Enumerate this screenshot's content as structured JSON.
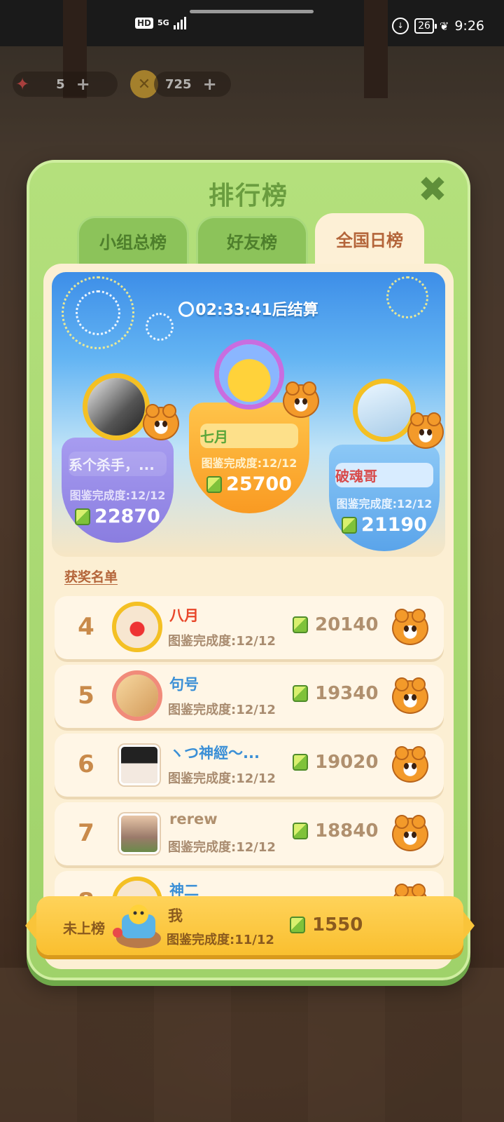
{
  "status_bar": {
    "hd": "HD",
    "network": "5G",
    "battery": "26",
    "time": "9:26"
  },
  "resources": {
    "stamina": "5",
    "coins": "725"
  },
  "panel": {
    "title": "排行榜",
    "tabs": [
      {
        "label": "小组总榜",
        "active": false
      },
      {
        "label": "好友榜",
        "active": false
      },
      {
        "label": "全国日榜",
        "active": true
      }
    ],
    "timer": {
      "time": "02:33:41",
      "suffix": "后结算"
    },
    "podium": {
      "first": {
        "name": "七月",
        "progress": "图鉴完成度:12/12",
        "score": "25700"
      },
      "second": {
        "name": "系个杀手，...",
        "progress": "图鉴完成度:12/12",
        "score": "22870"
      },
      "third": {
        "name": "破魂哥",
        "progress": "图鉴完成度:12/12",
        "score": "21190"
      }
    },
    "award_title": "获奖名单",
    "list": [
      {
        "rank": "4",
        "name": "八月",
        "progress": "图鉴完成度:12/12",
        "score": "20140",
        "name_color": "#e8472a"
      },
      {
        "rank": "5",
        "name": "句号",
        "progress": "图鉴完成度:12/12",
        "score": "19340",
        "name_color": "#3a8fd6"
      },
      {
        "rank": "6",
        "name": "ヽつ神經～...",
        "progress": "图鉴完成度:12/12",
        "score": "19020",
        "name_color": "#3a8fd6"
      },
      {
        "rank": "7",
        "name": "rerew",
        "progress": "图鉴完成度:12/12",
        "score": "18840",
        "name_color": "#b0906e"
      },
      {
        "rank": "8",
        "name": "神二",
        "progress": "",
        "score": "",
        "name_color": "#3a8fd6"
      }
    ],
    "me": {
      "status": "未上榜",
      "name": "我",
      "progress": "图鉴完成度:11/12",
      "score": "1550"
    }
  },
  "colors": {
    "panel_green": "#9fd26a",
    "tab_active_text": "#b4653a",
    "first_place": "#f9a62a",
    "second_place": "#9a8de8",
    "third_place": "#6fb4ee",
    "my_bar": "#f9bf2f"
  },
  "icons": [
    "close-icon",
    "clock-icon",
    "cube-icon",
    "tiger-badge-icon",
    "coin-icon",
    "firework-icon"
  ]
}
